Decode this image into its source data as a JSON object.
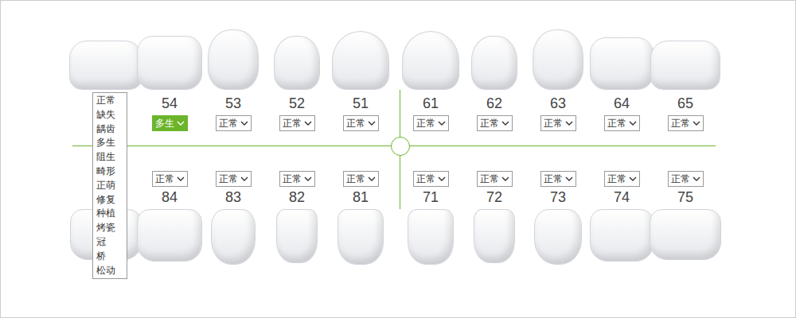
{
  "upper_teeth": [
    {
      "number": null,
      "status": null,
      "highlighted": false
    },
    {
      "number": "54",
      "status": "多生",
      "highlighted": true
    },
    {
      "number": "53",
      "status": "正常",
      "highlighted": false
    },
    {
      "number": "52",
      "status": "正常",
      "highlighted": false
    },
    {
      "number": "51",
      "status": "正常",
      "highlighted": false
    },
    {
      "number": "61",
      "status": "正常",
      "highlighted": false
    },
    {
      "number": "62",
      "status": "正常",
      "highlighted": false
    },
    {
      "number": "63",
      "status": "正常",
      "highlighted": false
    },
    {
      "number": "64",
      "status": "正常",
      "highlighted": false
    },
    {
      "number": "65",
      "status": "正常",
      "highlighted": false
    }
  ],
  "lower_teeth": [
    {
      "number": null,
      "status": null,
      "highlighted": false
    },
    {
      "number": "84",
      "status": "正常",
      "highlighted": false
    },
    {
      "number": "83",
      "status": "正常",
      "highlighted": false
    },
    {
      "number": "82",
      "status": "正常",
      "highlighted": false
    },
    {
      "number": "81",
      "status": "正常",
      "highlighted": false
    },
    {
      "number": "71",
      "status": "正常",
      "highlighted": false
    },
    {
      "number": "72",
      "status": "正常",
      "highlighted": false
    },
    {
      "number": "73",
      "status": "正常",
      "highlighted": false
    },
    {
      "number": "74",
      "status": "正常",
      "highlighted": false
    },
    {
      "number": "75",
      "status": "正常",
      "highlighted": false
    }
  ],
  "dropdown_menu": {
    "options": [
      "正常",
      "缺失",
      "龋齿",
      "多生",
      "阻生",
      "畸形",
      "正萌",
      "修复",
      "种植",
      "烤瓷",
      "冠",
      "桥",
      "松动"
    ]
  }
}
